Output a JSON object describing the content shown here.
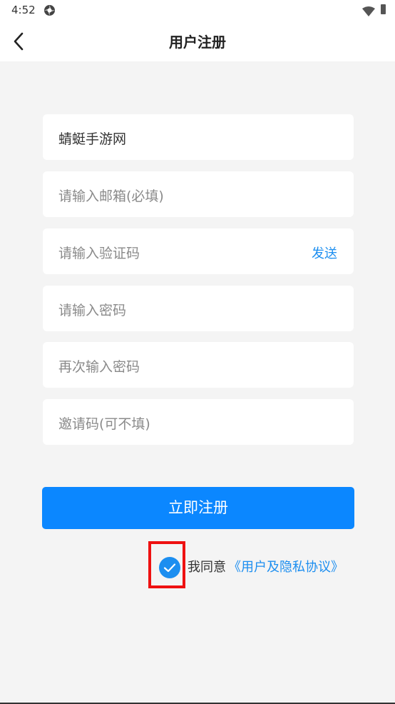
{
  "status_bar": {
    "time": "4:52"
  },
  "header": {
    "title": "用户注册"
  },
  "form": {
    "username_value": "蜻蜓手游网",
    "email_placeholder": "请输入邮箱(必填)",
    "code_placeholder": "请输入验证码",
    "send_label": "发送",
    "password_placeholder": "请输入密码",
    "confirm_placeholder": "再次输入密码",
    "invite_placeholder": "邀请码(可不填)"
  },
  "register_button": "立即注册",
  "agreement": {
    "checked": true,
    "prefix": "我同意",
    "link": "《用户及隐私协议》"
  },
  "colors": {
    "accent": "#0b87ff",
    "link": "#1c8ef0",
    "highlight": "#ee1111"
  }
}
